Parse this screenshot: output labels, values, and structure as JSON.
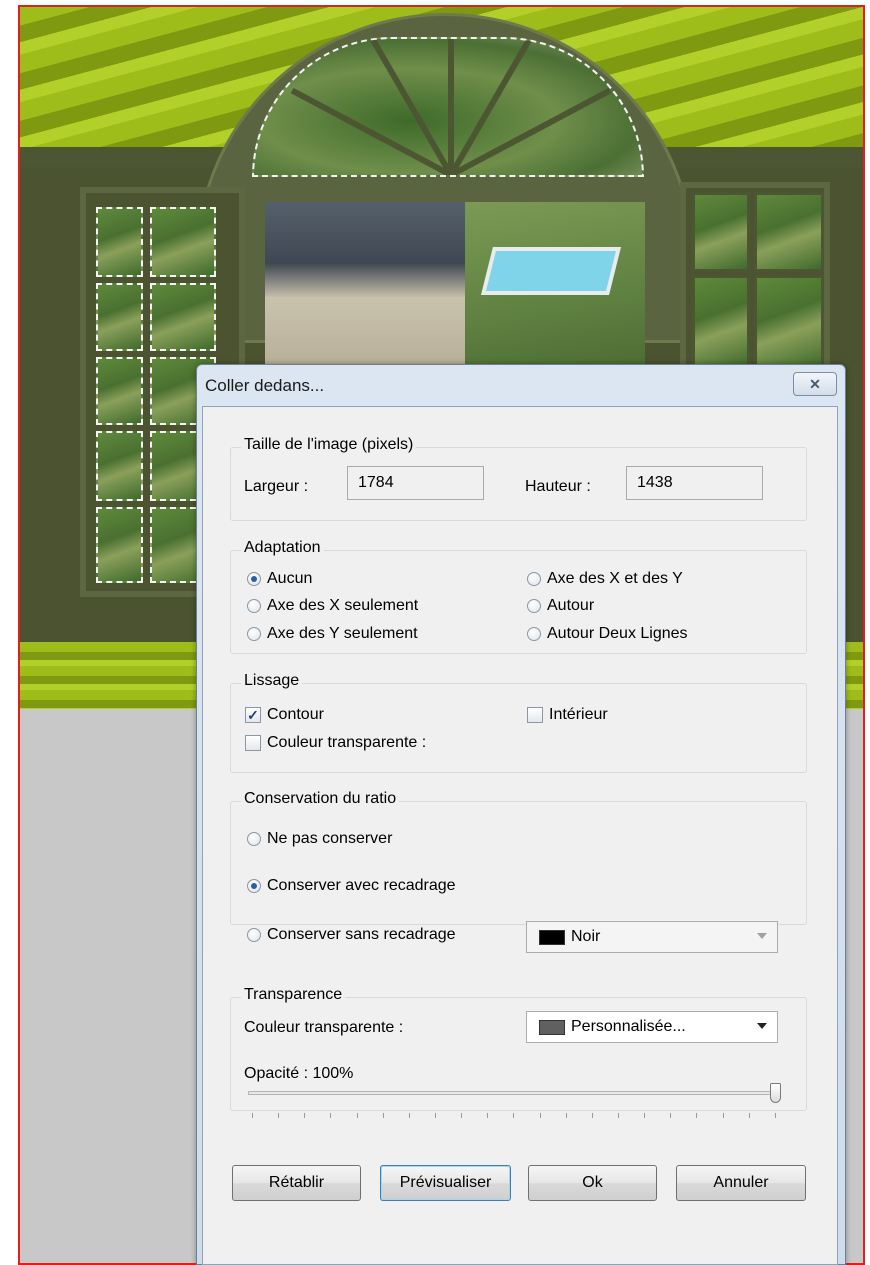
{
  "dialog": {
    "title": "Coller dedans...",
    "close_glyph": "✕",
    "image_size": {
      "legend": "Taille de l'image (pixels)",
      "width_label": "Largeur :",
      "width_value": "1784",
      "height_label": "Hauteur :",
      "height_value": "1438"
    },
    "adaptation": {
      "legend": "Adaptation",
      "options": [
        {
          "label": "Aucun",
          "selected": true
        },
        {
          "label": "Axe des X seulement",
          "selected": false
        },
        {
          "label": "Axe des Y seulement",
          "selected": false
        },
        {
          "label": "Axe des X et des Y",
          "selected": false
        },
        {
          "label": "Autour",
          "selected": false
        },
        {
          "label": "Autour Deux Lignes",
          "selected": false
        }
      ]
    },
    "lissage": {
      "legend": "Lissage",
      "contour": {
        "label": "Contour",
        "checked": true
      },
      "interieur": {
        "label": "Intérieur",
        "checked": false
      },
      "transparent": {
        "label": "Couleur transparente :",
        "checked": false
      }
    },
    "ratio": {
      "legend": "Conservation du ratio",
      "options": [
        {
          "label": "Ne pas conserver",
          "selected": false
        },
        {
          "label": "Conserver avec recadrage",
          "selected": true
        },
        {
          "label": "Conserver sans recadrage",
          "selected": false
        }
      ],
      "fill_color": {
        "label": "Noir",
        "swatch": "#000000"
      }
    },
    "transparence": {
      "legend": "Transparence",
      "color_label": "Couleur transparente :",
      "color": {
        "label": "Personnalisée...",
        "swatch": "#606060"
      },
      "opacity_label": "Opacité : 100%",
      "opacity_value": 100
    },
    "buttons": {
      "reset": "Rétablir",
      "preview": "Prévisualiser",
      "ok": "Ok",
      "cancel": "Annuler"
    }
  },
  "colors": {
    "accent_red_border": "#e0201e",
    "frame_green": "#4d5632",
    "stripe_green": "#9fbd1a"
  }
}
